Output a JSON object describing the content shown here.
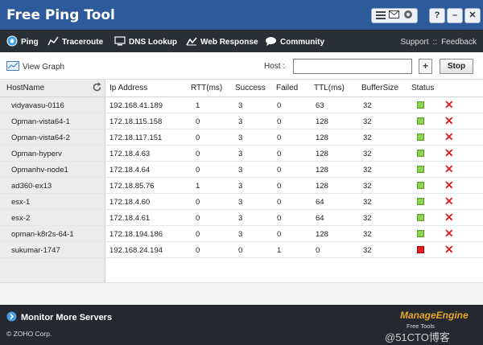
{
  "app": {
    "title": "Free Ping Tool"
  },
  "window_controls": {
    "help": "?",
    "minimize": "–",
    "close": "✕"
  },
  "nav": {
    "items": [
      {
        "label": "Ping"
      },
      {
        "label": "Traceroute"
      },
      {
        "label": "DNS Lookup"
      },
      {
        "label": "Web Response"
      },
      {
        "label": "Community"
      }
    ],
    "support": "Support",
    "separator": "::",
    "feedback": "Feedback"
  },
  "toolbar": {
    "view_graph": "View Graph",
    "host_label": "Host :",
    "host_value": "",
    "add": "+",
    "stop": "Stop"
  },
  "table": {
    "headers": [
      "HostName",
      "Ip Address",
      "RTT(ms)",
      "Success",
      "Failed",
      "TTL(ms)",
      "BufferSize",
      "Status"
    ],
    "rows": [
      {
        "host": "vidyavasu-0116",
        "ip": "192.168.41.189",
        "rtt": "1",
        "success": "3",
        "failed": "0",
        "ttl": "63",
        "buffer": "32",
        "status": "up"
      },
      {
        "host": "Opman-vista64-1",
        "ip": "172.18.115.158",
        "rtt": "0",
        "success": "3",
        "failed": "0",
        "ttl": "128",
        "buffer": "32",
        "status": "up"
      },
      {
        "host": "Opman-vista64-2",
        "ip": "172.18.117.151",
        "rtt": "0",
        "success": "3",
        "failed": "0",
        "ttl": "128",
        "buffer": "32",
        "status": "up"
      },
      {
        "host": "Opman-hyperv",
        "ip": "172.18.4.63",
        "rtt": "0",
        "success": "3",
        "failed": "0",
        "ttl": "128",
        "buffer": "32",
        "status": "up"
      },
      {
        "host": "Opmanhv-node1",
        "ip": "172.18.4.64",
        "rtt": "0",
        "success": "3",
        "failed": "0",
        "ttl": "128",
        "buffer": "32",
        "status": "up"
      },
      {
        "host": "ad360-ex13",
        "ip": "172.18.85.76",
        "rtt": "1",
        "success": "3",
        "failed": "0",
        "ttl": "128",
        "buffer": "32",
        "status": "up"
      },
      {
        "host": "esx-1",
        "ip": "172.18.4.60",
        "rtt": "0",
        "success": "3",
        "failed": "0",
        "ttl": "64",
        "buffer": "32",
        "status": "up"
      },
      {
        "host": "esx-2",
        "ip": "172.18.4.61",
        "rtt": "0",
        "success": "3",
        "failed": "0",
        "ttl": "64",
        "buffer": "32",
        "status": "up"
      },
      {
        "host": "opman-k8r2s-64-1",
        "ip": "172.18.194.186",
        "rtt": "0",
        "success": "3",
        "failed": "0",
        "ttl": "128",
        "buffer": "32",
        "status": "up"
      },
      {
        "host": "sukumar-1747",
        "ip": "192.168.24.194",
        "rtt": "0",
        "success": "0",
        "failed": "1",
        "ttl": "0",
        "buffer": "32",
        "status": "down"
      }
    ]
  },
  "footer": {
    "monitor": "Monitor More Servers",
    "copyright": "© ZOHO Corp.",
    "brand": "ManageEngine",
    "brand_sub": "Free Tools",
    "watermark": "@51CTO博客"
  },
  "colors": {
    "titlebar": "#2c5a9a",
    "navbar": "#2a2e35",
    "status_up": "#8dd14f",
    "status_down": "#e02020",
    "delete": "#d8262a",
    "brand": "#e8a62a"
  }
}
